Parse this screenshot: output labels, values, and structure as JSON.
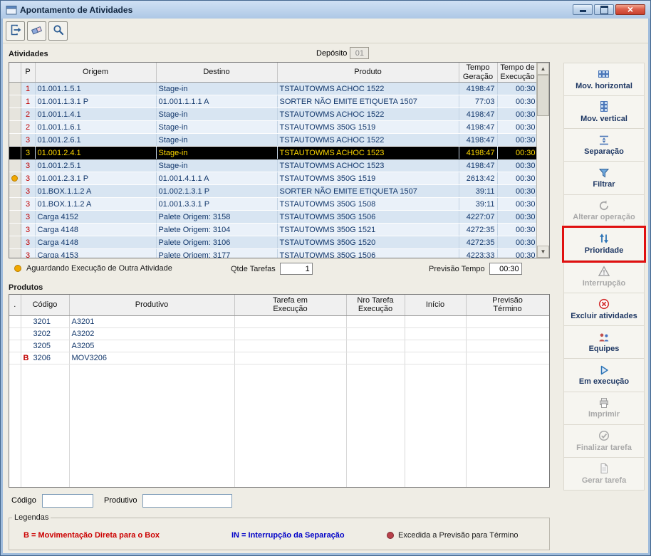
{
  "window": {
    "title": "Apontamento de Atividades"
  },
  "activities": {
    "section_label": "Atividades",
    "deposito_label": "Depósito",
    "deposito_value": "01",
    "columns": [
      "",
      "P",
      "Origem",
      "Destino",
      "Produto",
      "Tempo\nGeração",
      "Tempo de\nExecução"
    ],
    "rows": [
      {
        "dot": false,
        "selected": false,
        "p": "1",
        "origem": "01.001.1.5.1",
        "destino": "Stage-in",
        "produto": "TSTAUTOWMS ACHOC 1522",
        "tempo_geracao": "4198:47",
        "tempo_execucao": "00:30"
      },
      {
        "dot": false,
        "selected": false,
        "p": "1",
        "origem": "01.001.1.3.1 P",
        "destino": "01.001.1.1.1 A",
        "produto": "SORTER NÃO EMITE ETIQUETA 1507",
        "tempo_geracao": "77:03",
        "tempo_execucao": "00:30"
      },
      {
        "dot": false,
        "selected": false,
        "p": "2",
        "origem": "01.001.1.4.1",
        "destino": "Stage-in",
        "produto": "TSTAUTOWMS ACHOC 1522",
        "tempo_geracao": "4198:47",
        "tempo_execucao": "00:30"
      },
      {
        "dot": false,
        "selected": false,
        "p": "2",
        "origem": "01.001.1.6.1",
        "destino": "Stage-in",
        "produto": "TSTAUTOWMS 350G 1519",
        "tempo_geracao": "4198:47",
        "tempo_execucao": "00:30"
      },
      {
        "dot": false,
        "selected": false,
        "p": "3",
        "origem": "01.001.2.6.1",
        "destino": "Stage-in",
        "produto": "TSTAUTOWMS ACHOC 1522",
        "tempo_geracao": "4198:47",
        "tempo_execucao": "00:30"
      },
      {
        "dot": false,
        "selected": true,
        "p": "3",
        "origem": "01.001.2.4.1",
        "destino": "Stage-in",
        "produto": "TSTAUTOWMS ACHOC 1523",
        "tempo_geracao": "4198:47",
        "tempo_execucao": "00:30"
      },
      {
        "dot": false,
        "selected": false,
        "p": "3",
        "origem": "01.001.2.5.1",
        "destino": "Stage-in",
        "produto": "TSTAUTOWMS ACHOC 1523",
        "tempo_geracao": "4198:47",
        "tempo_execucao": "00:30"
      },
      {
        "dot": true,
        "selected": false,
        "p": "3",
        "origem": "01.001.2.3.1 P",
        "destino": "01.001.4.1.1 A",
        "produto": "TSTAUTOWMS 350G 1519",
        "tempo_geracao": "2613:42",
        "tempo_execucao": "00:30"
      },
      {
        "dot": false,
        "selected": false,
        "p": "3",
        "origem": "01.BOX.1.1.2 A",
        "destino": "01.002.1.3.1 P",
        "produto": "SORTER NÃO EMITE ETIQUETA 1507",
        "tempo_geracao": "39:11",
        "tempo_execucao": "00:30"
      },
      {
        "dot": false,
        "selected": false,
        "p": "3",
        "origem": "01.BOX.1.1.2 A",
        "destino": "01.001.3.3.1 P",
        "produto": "TSTAUTOWMS 350G 1508",
        "tempo_geracao": "39:11",
        "tempo_execucao": "00:30"
      },
      {
        "dot": false,
        "selected": false,
        "p": "3",
        "origem": "Carga 4152",
        "destino": "Palete Origem: 3158",
        "produto": "TSTAUTOWMS 350G 1506",
        "tempo_geracao": "4227:07",
        "tempo_execucao": "00:30"
      },
      {
        "dot": false,
        "selected": false,
        "p": "3",
        "origem": "Carga 4148",
        "destino": "Palete Origem: 3104",
        "produto": "TSTAUTOWMS 350G 1521",
        "tempo_geracao": "4272:35",
        "tempo_execucao": "00:30"
      },
      {
        "dot": false,
        "selected": false,
        "p": "3",
        "origem": "Carga 4148",
        "destino": "Palete Origem: 3106",
        "produto": "TSTAUTOWMS 350G 1520",
        "tempo_geracao": "4272:35",
        "tempo_execucao": "00:30"
      },
      {
        "dot": false,
        "selected": false,
        "p": "3",
        "origem": "Carga 4153",
        "destino": "Palete Origem: 3177",
        "produto": "TSTAUTOWMS 350G 1506",
        "tempo_geracao": "4223:33",
        "tempo_execucao": "00:30"
      }
    ]
  },
  "status": {
    "waiting_label": "Aguardando Execução de Outra Atividade",
    "qtde_label": "Qtde Tarefas",
    "qtde_value": "1",
    "previsao_label": "Previsão Tempo",
    "previsao_value": "00:30"
  },
  "products": {
    "section_label": "Produtos",
    "columns": [
      ".",
      "Código",
      "Produtivo",
      "Tarefa em\nExecução",
      "Nro Tarefa\nExecução",
      "Início",
      "Previsão\nTérmino"
    ],
    "rows": [
      {
        "flag": "",
        "codigo": "3201",
        "produtivo": "A3201",
        "tarefa_execucao": "",
        "nro_tarefa": "",
        "inicio": "",
        "previsao_termino": ""
      },
      {
        "flag": "",
        "codigo": "3202",
        "produtivo": "A3202",
        "tarefa_execucao": "",
        "nro_tarefa": "",
        "inicio": "",
        "previsao_termino": ""
      },
      {
        "flag": "",
        "codigo": "3205",
        "produtivo": "A3205",
        "tarefa_execucao": "",
        "nro_tarefa": "",
        "inicio": "",
        "previsao_termino": ""
      },
      {
        "flag": "B",
        "codigo": "3206",
        "produtivo": "MOV3206",
        "tarefa_execucao": "",
        "nro_tarefa": "",
        "inicio": "",
        "previsao_termino": ""
      }
    ]
  },
  "filters": {
    "codigo_label": "Código",
    "codigo_value": "",
    "produtivo_label": "Produtivo",
    "produtivo_value": ""
  },
  "legends": {
    "title": "Legendas",
    "items": [
      {
        "text": "B = Movimentação Direta para o Box",
        "color": "#CC0000"
      },
      {
        "text": "IN = Interrupção da Separação",
        "color": "#0000C8"
      },
      {
        "text": "Excedida a Previsão para Término",
        "dot_color": "#B8414B"
      }
    ]
  },
  "sidebar": {
    "buttons": [
      {
        "label": "Mov. horizontal",
        "enabled": true,
        "highlighted": false
      },
      {
        "label": "Mov. vertical",
        "enabled": true,
        "highlighted": false
      },
      {
        "label": "Separação",
        "enabled": true,
        "highlighted": false
      },
      {
        "label": "Filtrar",
        "enabled": true,
        "highlighted": false
      },
      {
        "label": "Alterar operação",
        "enabled": false,
        "highlighted": false
      },
      {
        "label": "Prioridade",
        "enabled": true,
        "highlighted": true
      },
      {
        "label": "Interrupção",
        "enabled": false,
        "highlighted": false
      },
      {
        "label": "Excluir atividades",
        "enabled": true,
        "highlighted": false
      },
      {
        "label": "Equipes",
        "enabled": true,
        "highlighted": false
      },
      {
        "label": "Em execução",
        "enabled": true,
        "highlighted": false
      },
      {
        "label": "Imprimir",
        "enabled": false,
        "highlighted": false
      },
      {
        "label": "Finalizar tarefa",
        "enabled": false,
        "highlighted": false
      },
      {
        "label": "Gerar tarefa",
        "enabled": false,
        "highlighted": false
      }
    ]
  }
}
